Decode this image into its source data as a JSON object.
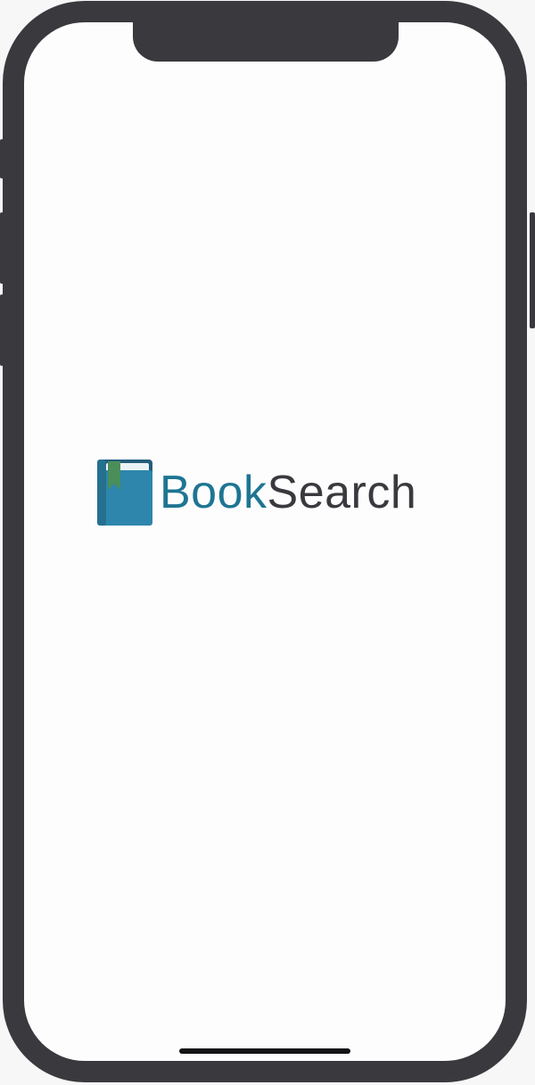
{
  "app": {
    "name_part_1": "Book",
    "name_part_2": "Search",
    "logo_icon": "bookmarked-book-icon"
  },
  "colors": {
    "brand_blue": "#1e7592",
    "book_cover": "#2e86ad",
    "book_spine": "#245e7a",
    "bookmark_green": "#4a8e5a",
    "text_dark": "#3a393e",
    "device_frame": "#3a393e",
    "screen_background": "#fefdfe"
  }
}
